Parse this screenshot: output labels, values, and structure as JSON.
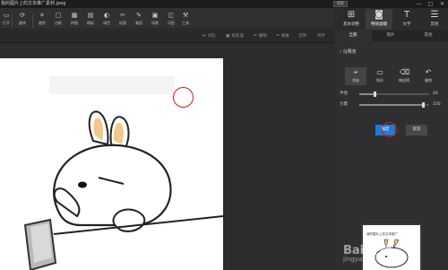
{
  "window": {
    "title": "我的图片上的文本推广素材.jpeg",
    "search_label": "搜索",
    "minimize": "—",
    "maximize": "□",
    "close": "✕"
  },
  "toolbar": {
    "items": [
      {
        "label": "打开",
        "icon": "folder-icon"
      },
      {
        "label": "旋转",
        "icon": "rotate-icon"
      },
      {
        "label": "裁剪",
        "icon": "crop-icon"
      },
      {
        "label": "边框",
        "icon": "frame-icon"
      },
      {
        "label": "拼图",
        "icon": "collage-icon"
      },
      {
        "label": "模板",
        "icon": "template-icon"
      },
      {
        "label": "调色",
        "icon": "color-icon"
      },
      {
        "label": "抠图",
        "icon": "cutout-icon"
      },
      {
        "label": "美容",
        "icon": "beauty-icon"
      },
      {
        "label": "场景",
        "icon": "scene-icon"
      },
      {
        "label": "闪图",
        "icon": "flash-icon"
      },
      {
        "label": "工具",
        "icon": "tools-icon"
      }
    ]
  },
  "right_tabs": [
    {
      "label": "基本调整",
      "icon": "adjust-icon"
    },
    {
      "label": "特效滤镜",
      "icon": "filter-icon"
    },
    {
      "label": "文字",
      "icon": "text-icon"
    },
    {
      "label": "其他",
      "icon": "more-icon"
    }
  ],
  "subbar": {
    "actions": [
      "对比",
      "批处理",
      "撤销",
      "重做",
      "还原",
      "另存"
    ]
  },
  "right_subtabs": [
    "全部",
    "照片",
    "其他"
  ],
  "panel": {
    "head": "‹ 马赛克",
    "tools": [
      {
        "label": "涂抹",
        "icon": "brush-icon"
      },
      {
        "label": "矩形",
        "icon": "rect-icon"
      },
      {
        "label": "橡皮擦",
        "icon": "eraser-icon"
      },
      {
        "label": "撤销",
        "icon": "undo-icon"
      }
    ],
    "sliders": [
      {
        "label": "半径",
        "value": "40",
        "level": 0.22
      },
      {
        "label": "力量",
        "value": "100",
        "level": 0.92
      }
    ],
    "ok": "确定",
    "cancel": "取消",
    "thumb_caption": "我的图片上的文本推广"
  },
  "watermark": {
    "main": "Bai 经验",
    "sub": "jingyan.baidu.com"
  },
  "colors": {
    "accent": "#1f7ad6",
    "highlight_circle": "#d11c1c"
  }
}
